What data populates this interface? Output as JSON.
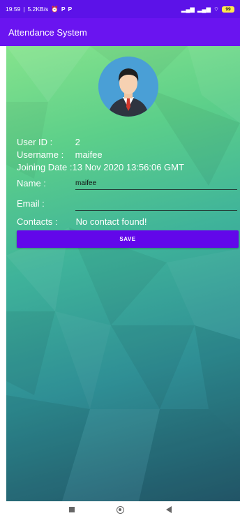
{
  "statusbar": {
    "time": "19:59",
    "speed": "5.2KB/s",
    "app_icons": [
      "alarm-icon",
      "p-icon",
      "p-icon"
    ],
    "signal_icons": [
      "signal-icon",
      "signal-icon",
      "wifi-icon"
    ],
    "battery": "99"
  },
  "appbar": {
    "title": "Attendance System"
  },
  "profile": {
    "user_id_label": "User ID :",
    "user_id_value": "2",
    "username_label": "Username :",
    "username_value": "maifee",
    "joining_label": "Joining Date :",
    "joining_value": "13 Nov 2020 13:56:06 GMT",
    "name_label": "Name :",
    "name_value": "maifee",
    "email_label": "Email :",
    "email_value": "",
    "contacts_label": "Contacts :",
    "contacts_value": "No contact found!"
  },
  "buttons": {
    "save": "SAVE"
  },
  "colors": {
    "statusbar": "#5c12e8",
    "appbar": "#6a14f0",
    "button": "#6207ea"
  }
}
